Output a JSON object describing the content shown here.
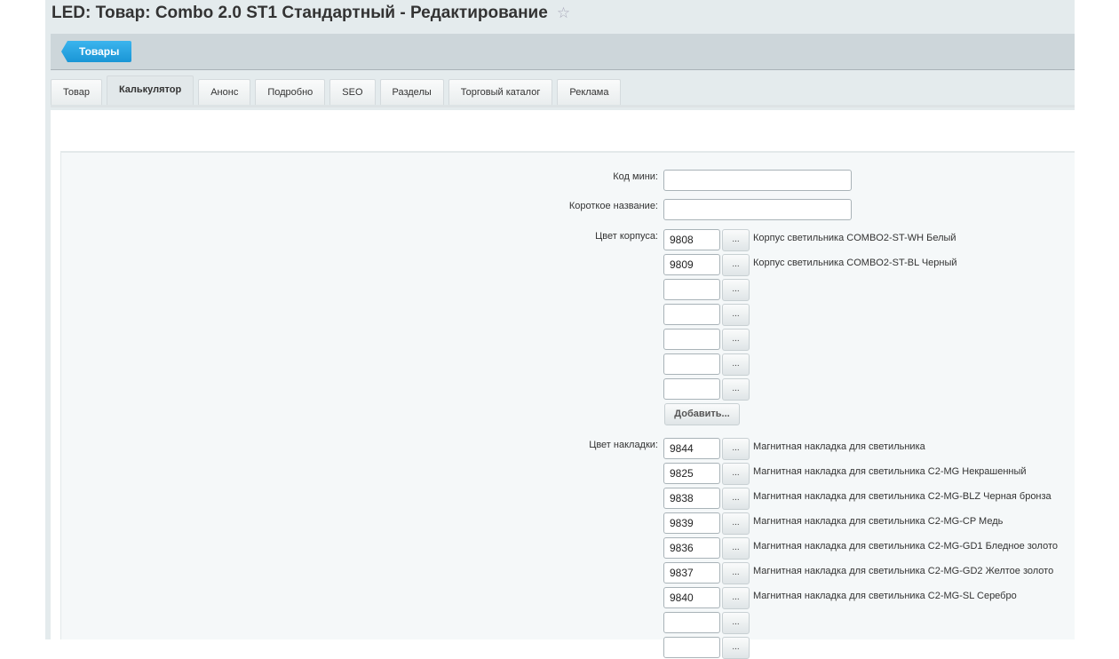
{
  "title": "LED: Товар: Combo 2.0 ST1 Стандартный - Редактирование",
  "toolbar": {
    "back_label": "Товары"
  },
  "tabs": [
    "Товар",
    "Калькулятор",
    "Анонс",
    "Подробно",
    "SEO",
    "Разделы",
    "Торговый каталог",
    "Реклама"
  ],
  "active_tab": "Калькулятор",
  "form": {
    "kod_mini": {
      "label": "Код мини:",
      "value": ""
    },
    "short_name": {
      "label": "Короткое название:",
      "value": ""
    },
    "body_color": {
      "label": "Цвет корпуса:",
      "rows": [
        {
          "id": "9808",
          "desc": "Корпус светильника COMBO2-ST-WH Белый"
        },
        {
          "id": "9809",
          "desc": "Корпус светильника COMBO2-ST-BL Черный"
        },
        {
          "id": "",
          "desc": ""
        },
        {
          "id": "",
          "desc": ""
        },
        {
          "id": "",
          "desc": ""
        },
        {
          "id": "",
          "desc": ""
        },
        {
          "id": "",
          "desc": ""
        }
      ],
      "add_label": "Добавить...",
      "pick_label": "..."
    },
    "overlay_color": {
      "label": "Цвет накладки:",
      "rows": [
        {
          "id": "9844",
          "desc": "Магнитная накладка для светильника"
        },
        {
          "id": "9825",
          "desc": "Магнитная накладка для светильника C2-MG Некрашенный"
        },
        {
          "id": "9838",
          "desc": "Магнитная накладка для светильника C2-MG-BLZ Черная бронза"
        },
        {
          "id": "9839",
          "desc": "Магнитная накладка для светильника C2-MG-CP Медь"
        },
        {
          "id": "9836",
          "desc": "Магнитная накладка для светильника C2-MG-GD1 Бледное золото"
        },
        {
          "id": "9837",
          "desc": "Магнитная накладка для светильника C2-MG-GD2 Желтое золото"
        },
        {
          "id": "9840",
          "desc": "Магнитная накладка для светильника C2-MG-SL Серебро"
        },
        {
          "id": "",
          "desc": ""
        },
        {
          "id": "",
          "desc": ""
        }
      ],
      "pick_label": "..."
    }
  }
}
